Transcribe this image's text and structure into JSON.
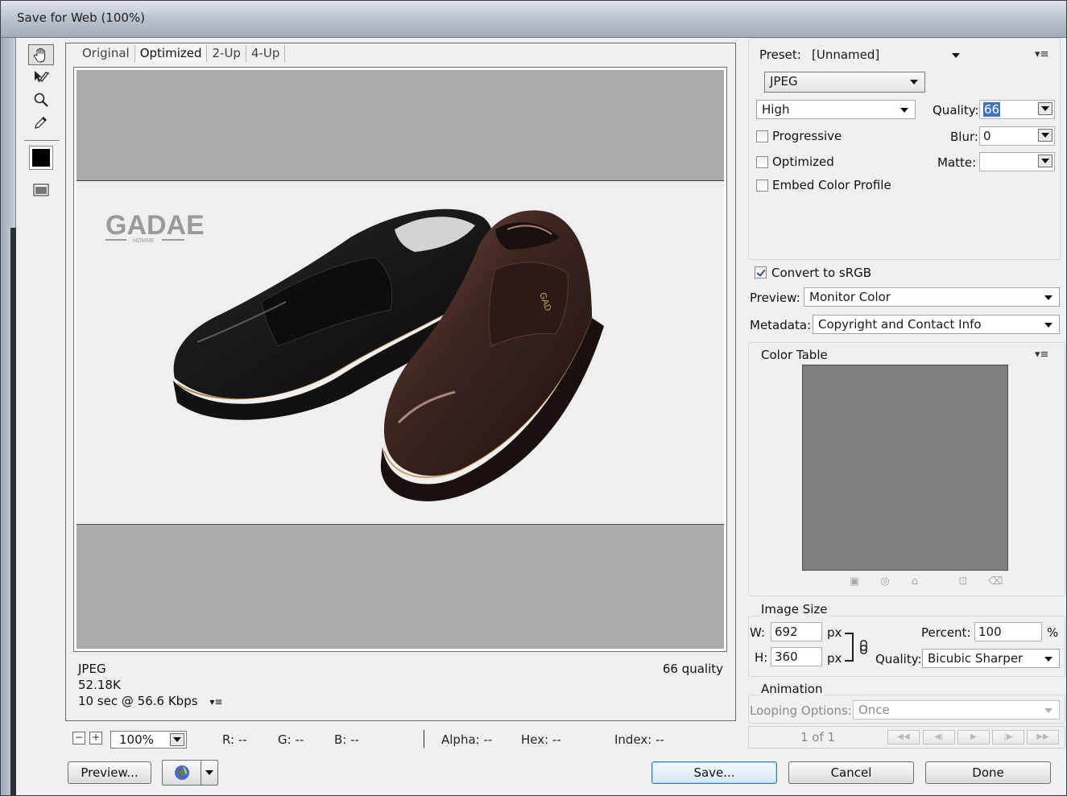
{
  "window": {
    "title": "Save for Web (100%)"
  },
  "tools": [
    {
      "name": "hand-tool",
      "icon": "hand-icon"
    },
    {
      "name": "slice-select-tool",
      "icon": "slice-select-icon"
    },
    {
      "name": "zoom-tool",
      "icon": "magnifier-icon"
    },
    {
      "name": "eyedropper-tool",
      "icon": "eyedropper-icon"
    },
    {
      "name": "eyedropper-color",
      "icon": "color-swatch",
      "color": "#000000"
    },
    {
      "name": "toggle-slices-visibility",
      "icon": "slices-visibility-icon"
    }
  ],
  "view_tabs": [
    "Original",
    "Optimized",
    "2-Up",
    "4-Up"
  ],
  "active_tab": "Optimized",
  "preview": {
    "logo_text": "GADAE",
    "logo_subtext": "HOMME",
    "shoe_tag": "GAD"
  },
  "image_info": {
    "format": "JPEG",
    "size": "52.18K",
    "download_time": "10 sec @ 56.6 Kbps",
    "quality_note": "66 quality"
  },
  "status_bar": {
    "zoom_out": "−",
    "zoom_in": "+",
    "zoom": "100%",
    "r": "R: --",
    "g": "G: --",
    "b": "B: --",
    "alpha": "Alpha: --",
    "hex": "Hex: --",
    "index": "Index: --"
  },
  "buttons": {
    "preview": "Preview...",
    "save": "Save...",
    "cancel": "Cancel",
    "done": "Done"
  },
  "settings": {
    "preset_label": "Preset:",
    "preset_value": "[Unnamed]",
    "format": "JPEG",
    "compression": "High",
    "quality_label": "Quality:",
    "quality_value": "66",
    "blur_label": "Blur:",
    "blur_value": "0",
    "matte_label": "Matte:",
    "progressive_label": "Progressive",
    "progressive_checked": false,
    "optimized_label": "Optimized",
    "optimized_checked": false,
    "embed_profile_label": "Embed Color Profile",
    "embed_profile_checked": false,
    "convert_srgb_label": "Convert to sRGB",
    "convert_srgb_checked": true,
    "preview_label": "Preview:",
    "preview_value": "Monitor Color",
    "metadata_label": "Metadata:",
    "metadata_value": "Copyright and Contact Info"
  },
  "color_table": {
    "title": "Color Table",
    "swatch_color": "#808080"
  },
  "image_size": {
    "title": "Image Size",
    "w_label": "W:",
    "w_value": "692",
    "h_label": "H:",
    "h_value": "360",
    "unit": "px",
    "percent_label": "Percent:",
    "percent_value": "100",
    "percent_unit": "%",
    "quality_label": "Quality:",
    "quality_value": "Bicubic Sharper"
  },
  "animation": {
    "title": "Animation",
    "looping_label": "Looping Options:",
    "looping_value": "Once",
    "frame_counter": "1 of 1"
  }
}
